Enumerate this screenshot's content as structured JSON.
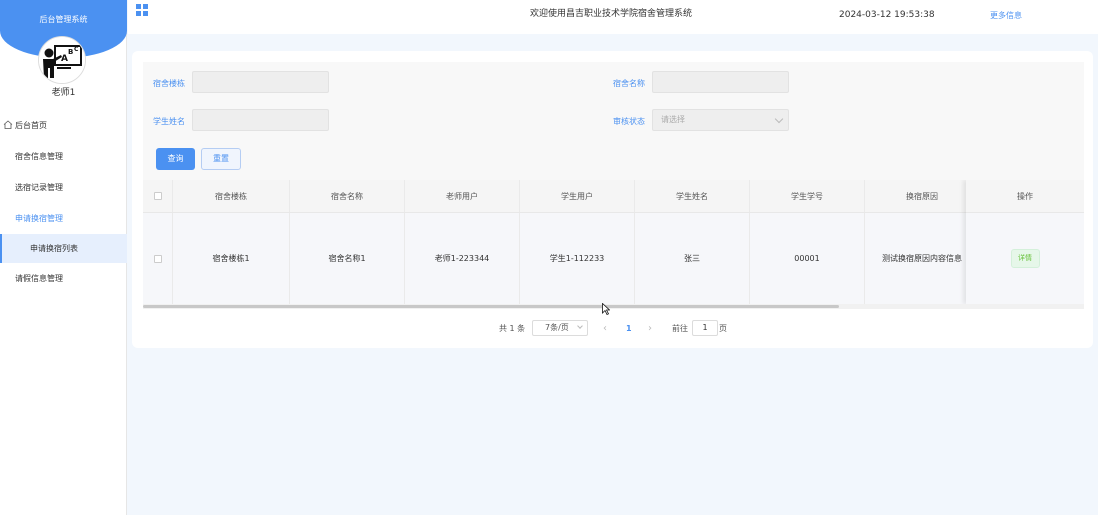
{
  "sidebar": {
    "title": "后台管理系统",
    "username": "老师1",
    "menu": [
      {
        "label": "后台首页"
      },
      {
        "label": "宿舍信息管理"
      },
      {
        "label": "选宿记录管理"
      },
      {
        "label": "申请换宿管理"
      },
      {
        "label": "申请换宿列表"
      },
      {
        "label": "请假信息管理"
      }
    ]
  },
  "header": {
    "welcome": "欢迎使用昌吉职业技术学院宿舍管理系统",
    "datetime": "2024-03-12 19:53:38",
    "more_info": "更多信息"
  },
  "search": {
    "dorm_building_label": "宿舍楼栋",
    "dorm_building_value": "",
    "dorm_name_label": "宿舍名称",
    "dorm_name_value": "",
    "student_name_label": "学生姓名",
    "student_name_value": "",
    "audit_status_label": "审核状态",
    "audit_status_placeholder": "请选择",
    "query_button": "查询",
    "reset_button": "重置"
  },
  "table": {
    "columns": [
      "宿舍楼栋",
      "宿舍名称",
      "老师用户",
      "学生用户",
      "学生姓名",
      "学生学号",
      "换宿原因",
      "操作"
    ],
    "rows": [
      {
        "building": "宿舍楼栋1",
        "dorm_name": "宿舍名称1",
        "teacher": "老师1-223344",
        "student_user": "学生1-112233",
        "student_name": "张三",
        "student_no": "00001",
        "reason": "测试换宿原因内容信息",
        "action": "详情"
      }
    ],
    "scroll_fraction": 0.74
  },
  "pagination": {
    "total": "共 1 条",
    "page_size": "7条/页",
    "current_page": "1",
    "goto_label": "前往",
    "goto_value": "1",
    "page_suffix": "页",
    "prev": "‹",
    "next": "›"
  },
  "colors": {
    "accent": "#4b91f1",
    "success": "#67c23a"
  }
}
